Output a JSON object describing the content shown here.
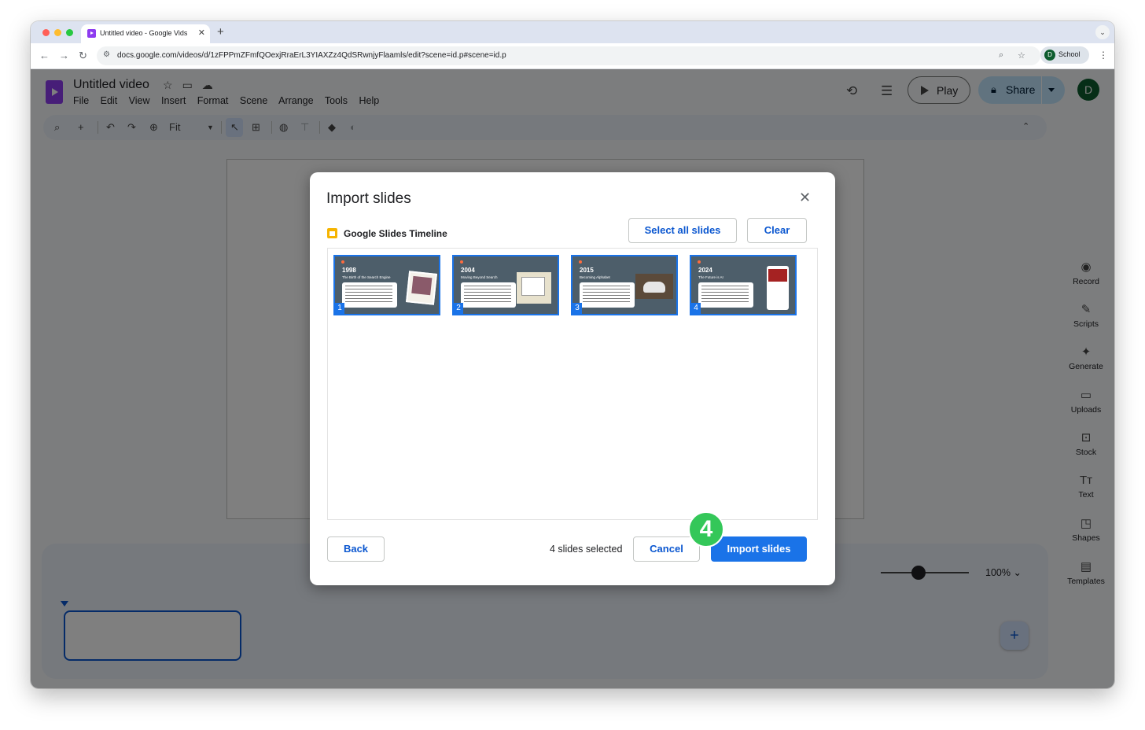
{
  "browser": {
    "tab_title": "Untitled video - Google Vids",
    "url": "docs.google.com/videos/d/1zFPPmZFmfQOexjRraErL3YIAXZz4QdSRwnjyFlaamls/edit?scene=id.p#scene=id.p",
    "profile_label": "School",
    "profile_initial": "D"
  },
  "app": {
    "doc_title": "Untitled video",
    "menu": [
      "File",
      "Edit",
      "View",
      "Insert",
      "Format",
      "Scene",
      "Arrange",
      "Tools",
      "Help"
    ],
    "play_label": "Play",
    "share_label": "Share",
    "avatar_initial": "D",
    "zoom_fit_label": "Fit",
    "timeline_zoom": "100%",
    "right_panel": [
      "Record",
      "Scripts",
      "Generate",
      "Uploads",
      "Stock",
      "Text",
      "Shapes",
      "Templates"
    ]
  },
  "dialog": {
    "title": "Import slides",
    "source_name": "Google Slides Timeline",
    "select_all_label": "Select all slides",
    "clear_label": "Clear",
    "slides": [
      {
        "number": "1",
        "year": "1998",
        "subtitle": "The Birth of the Search Engine"
      },
      {
        "number": "2",
        "year": "2004",
        "subtitle": "Moving Beyond Search"
      },
      {
        "number": "3",
        "year": "2015",
        "subtitle": "Becoming Alphabet"
      },
      {
        "number": "4",
        "year": "2024",
        "subtitle": "The Future is AI"
      }
    ],
    "back_label": "Back",
    "selected_count": "4 slides selected",
    "cancel_label": "Cancel",
    "import_label": "Import slides"
  },
  "annotation": {
    "step_number": "4",
    "color": "#34c759"
  },
  "colors": {
    "accent": "#1a73e8",
    "brand": "#8e3cf0",
    "share_bg": "#c2e7ff"
  }
}
